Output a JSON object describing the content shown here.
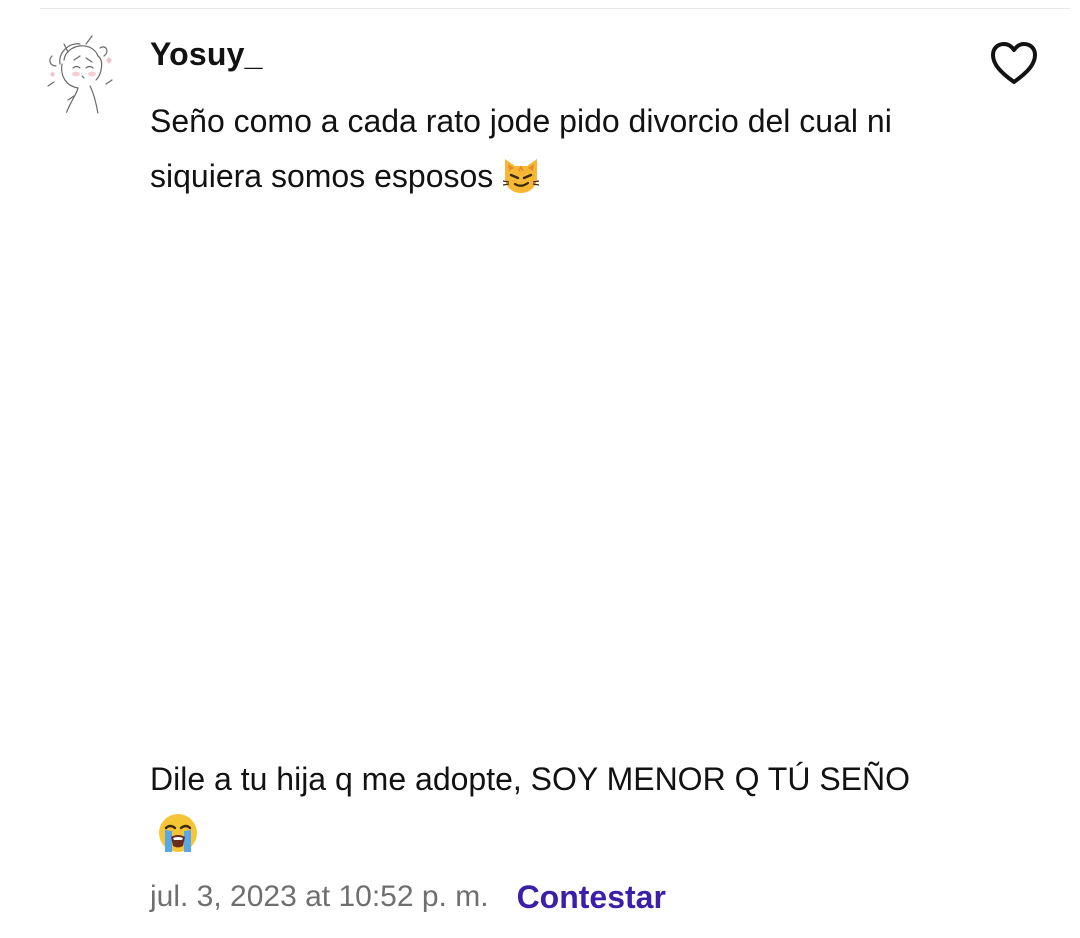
{
  "comment": {
    "username": "Yosuy_",
    "text_first": "Seño como a cada rato jode pido divorcio del cual ni siquiera somos esposos",
    "emoji_first": "smirking-cat-icon",
    "text_second": "Dile a tu hija q me adopte, SOY MENOR Q TÚ SEÑO",
    "emoji_second": "loudly-crying-face-icon",
    "timestamp": "jul. 3, 2023 at 10:52 p. m.",
    "reply_label": "Contestar",
    "liked": false
  },
  "colors": {
    "text": "#121212",
    "muted": "#6f6f6f",
    "accent": "#3b1fa8"
  }
}
